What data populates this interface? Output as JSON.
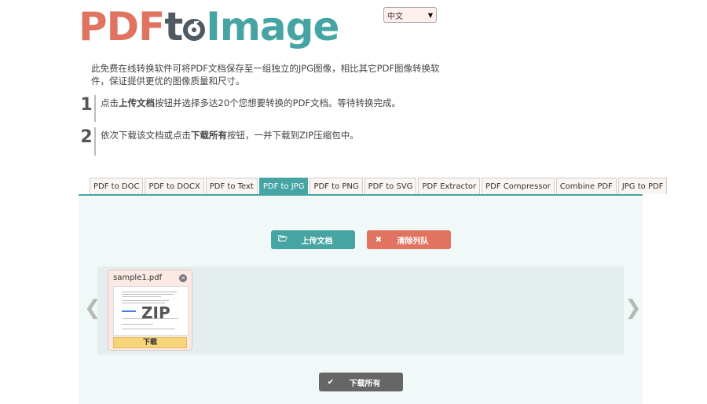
{
  "logo": {
    "part_pdf": "PDF",
    "part_to": "t",
    "part_o": "o",
    "part_image": "Image"
  },
  "language": {
    "selected": "中文"
  },
  "intro": "此免费在线转换软件可将PDF文档保存至一组独立的JPG图像，相比其它PDF图像转换软件，保证提供更优的图像质量和尺寸。",
  "steps": [
    {
      "number": "1",
      "before": "点击",
      "bold": "上传文档",
      "after": "按钮并选择多达20个您想要转换的PDF文档。等待转换完成。"
    },
    {
      "number": "2",
      "before": "依次下载该文档或点击",
      "bold": "下载所有",
      "after": "按钮，一并下载到ZIP压缩包中。"
    }
  ],
  "tabs": [
    {
      "label": "PDF to DOC",
      "active": false
    },
    {
      "label": "PDF to DOCX",
      "active": false
    },
    {
      "label": "PDF to Text",
      "active": false
    },
    {
      "label": "PDF to JPG",
      "active": true
    },
    {
      "label": "PDF to PNG",
      "active": false
    },
    {
      "label": "PDF to SVG",
      "active": false
    },
    {
      "label": "PDF Extractor",
      "active": false
    },
    {
      "label": "PDF Compressor",
      "active": false
    },
    {
      "label": "Combine PDF",
      "active": false
    },
    {
      "label": "JPG to PDF",
      "active": false
    }
  ],
  "buttons": {
    "upload": "上传文档",
    "clear": "清除列队",
    "download_all": "下载所有"
  },
  "queue": {
    "files": [
      {
        "name": "sample1.pdf",
        "thumb_text": "ZIP",
        "download": "下载"
      }
    ]
  },
  "colors": {
    "teal": "#46a5a2",
    "coral": "#e07461",
    "gray": "#666666",
    "dark": "#4f5a63"
  }
}
